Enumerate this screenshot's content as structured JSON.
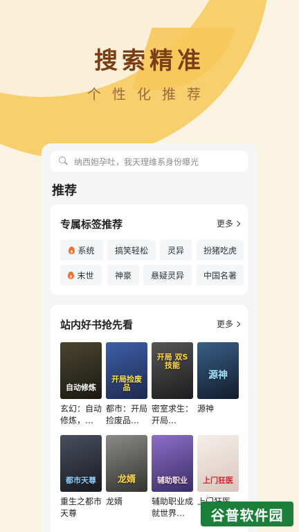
{
  "hero": {
    "title": "搜索精准",
    "subtitle": "个性化推荐"
  },
  "search": {
    "placeholder": "纳西妲孕吐，我天理维系身份曝光"
  },
  "recommend": {
    "heading": "推荐"
  },
  "tags_section": {
    "title": "专属标签推荐",
    "more": "更多",
    "tags": [
      {
        "label": "系统",
        "hot": true
      },
      {
        "label": "搞笑轻松",
        "hot": false
      },
      {
        "label": "灵异",
        "hot": false
      },
      {
        "label": "扮猪吃虎",
        "hot": false
      },
      {
        "label": "末世",
        "hot": true
      },
      {
        "label": "神豪",
        "hot": false
      },
      {
        "label": "悬疑灵异",
        "hot": false
      },
      {
        "label": "中国名著",
        "hot": false
      }
    ]
  },
  "books_section": {
    "title": "站内好书抢先看",
    "more": "更多",
    "books": [
      {
        "title": "玄幻：自动修炼，…",
        "cover_text": "自动修炼",
        "cover_color": "#2b2a1f"
      },
      {
        "title": "都市：开局捡废品…",
        "cover_text": "开局捡废品",
        "cover_color": "#2a3d6e"
      },
      {
        "title": "密室求生：开局…",
        "cover_text": "开局 双S技能",
        "cover_color": "#3a3a3a"
      },
      {
        "title": "源神",
        "cover_text": "源神",
        "cover_color": "#1d3552"
      },
      {
        "title": "重生之都市天尊",
        "cover_text": "都市天尊",
        "cover_color": "#2b2e38"
      },
      {
        "title": "龙婿",
        "cover_text": "龙婿",
        "cover_color": "#5a5c57"
      },
      {
        "title": "辅助职业成就世界…",
        "cover_text": "辅助职业",
        "cover_color": "#5b4a8c"
      },
      {
        "title": "上门狂医",
        "cover_text": "上门狂医",
        "cover_color": "#e9e2dc"
      }
    ]
  },
  "watermark": {
    "text": "谷普软件园"
  }
}
